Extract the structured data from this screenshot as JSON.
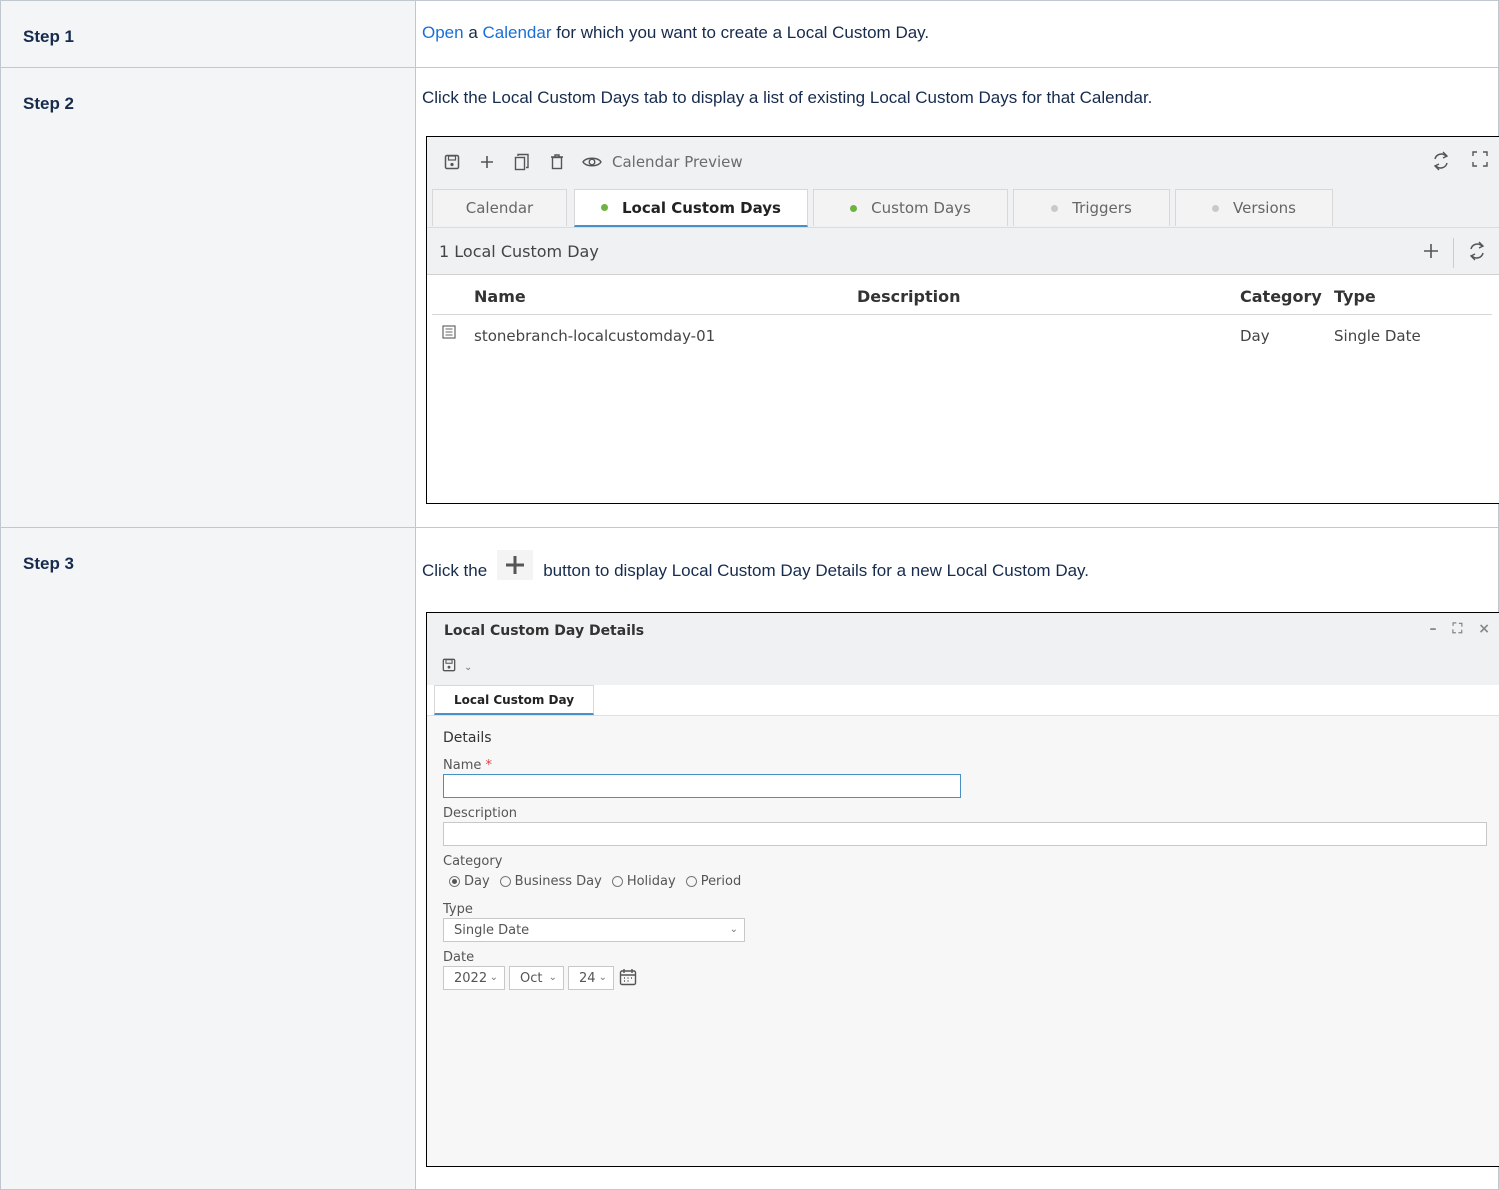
{
  "steps": [
    {
      "label": "Step 1",
      "text_parts": {
        "link1": "Open",
        "mid1": " a ",
        "link2": "Calendar",
        "rest": " for which you want to create a Local Custom Day."
      }
    },
    {
      "label": "Step 2",
      "text": "Click the Local Custom Days tab to display a list of existing Local Custom Days for that Calendar."
    },
    {
      "label": "Step 3",
      "text_before": "Click the",
      "text_after": "button to display Local Custom Day Details for a new Local Custom Day."
    }
  ],
  "calendar_panel": {
    "toolbar": {
      "icons": [
        "save-icon",
        "plus-icon",
        "copy-icon",
        "trash-icon",
        "eye-icon"
      ],
      "preview_label": "Calendar Preview",
      "right_icons": [
        "refresh-icon",
        "expand-icon"
      ]
    },
    "tabs": [
      {
        "label": "Calendar",
        "dot": "none",
        "active": false
      },
      {
        "label": "Local Custom Days",
        "dot": "green",
        "active": true
      },
      {
        "label": "Custom Days",
        "dot": "green",
        "active": false
      },
      {
        "label": "Triggers",
        "dot": "gray",
        "active": false
      },
      {
        "label": "Versions",
        "dot": "gray",
        "active": false
      }
    ],
    "list_title": "1 Local Custom Day",
    "columns": {
      "name": "Name",
      "description": "Description",
      "category": "Category",
      "type": "Type"
    },
    "rows": [
      {
        "icon": "record-icon",
        "name": "stonebranch-localcustomday-01",
        "description": "",
        "category": "Day",
        "type": "Single Date"
      }
    ]
  },
  "details_dialog": {
    "title": "Local Custom Day Details",
    "window_controls": {
      "minimize": "–",
      "maximize": "⛶",
      "close": "×"
    },
    "tab": "Local Custom Day",
    "section": "Details",
    "name_label": "Name",
    "required_mark": "*",
    "name_value": "",
    "description_label": "Description",
    "description_value": "",
    "category_label": "Category",
    "category_options": [
      "Day",
      "Business Day",
      "Holiday",
      "Period"
    ],
    "category_selected": "Day",
    "type_label": "Type",
    "type_value": "Single Date",
    "date_label": "Date",
    "date": {
      "year": "2022",
      "month": "Oct",
      "day": "24"
    }
  },
  "colors": {
    "link": "#1a6fd6",
    "active_tab_underline": "#4a90c8",
    "green_dot": "#6cb33f",
    "required": "#e04040"
  }
}
